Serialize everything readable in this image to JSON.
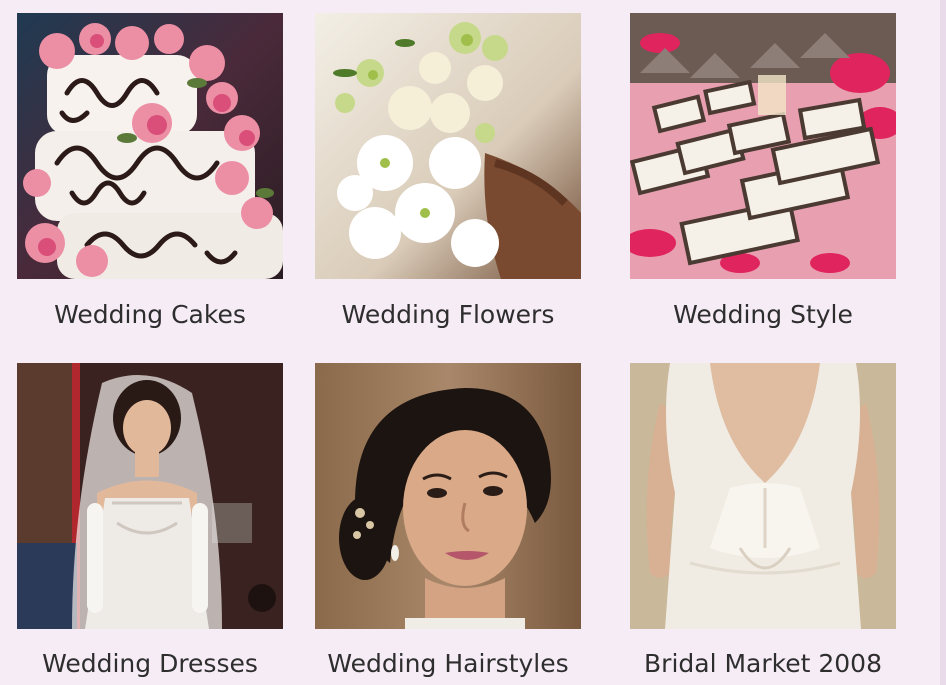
{
  "gallery": {
    "background_color": "#f6ecf6",
    "items": [
      {
        "label": "Wedding Cakes",
        "image": "wedding-cake-photo"
      },
      {
        "label": "Wedding Flowers",
        "image": "bouquet-photo"
      },
      {
        "label": "Wedding Style",
        "image": "place-cards-photo"
      },
      {
        "label": "Wedding Dresses",
        "image": "bridal-gown-photo"
      },
      {
        "label": "Wedding Hairstyles",
        "image": "bridal-hairstyle-photo"
      },
      {
        "label": "Bridal Market 2008",
        "image": "gown-back-photo"
      }
    ]
  }
}
